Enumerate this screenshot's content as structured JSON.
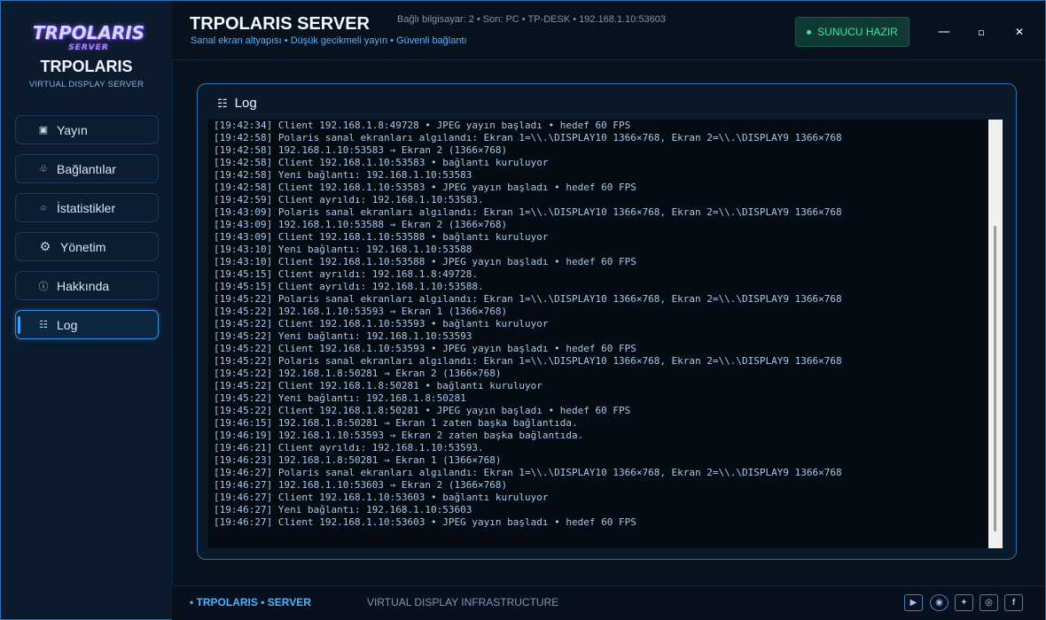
{
  "sidebar": {
    "logo_word": "TRPOLARIS",
    "logo_sub": "SERVER",
    "brand_name": "TRPOLARIS",
    "brand_sub": "VIRTUAL DISPLAY SERVER",
    "items": [
      {
        "label": "Yayın",
        "icon": "stream-icon",
        "glyph": "▣"
      },
      {
        "label": "Bağlantılar",
        "icon": "connection-icon",
        "glyph": "♧"
      },
      {
        "label": "İstatistikler",
        "icon": "stats-icon",
        "glyph": "○"
      },
      {
        "label": "Yönetim",
        "icon": "gear-icon",
        "glyph": "⚙"
      },
      {
        "label": "Hakkında",
        "icon": "info-icon",
        "glyph": "ⓘ"
      },
      {
        "label": "Log",
        "icon": "list-icon",
        "glyph": "☷",
        "active": true
      }
    ]
  },
  "header": {
    "title": "TRPOLARIS SERVER",
    "subtitle": "Sanal ekran altyapısı  •  Düşük gecikmeli yayın  •  Güvenli bağlantı",
    "connection_info": "Bağlı bilgisayar: 2  •  Son: PC • TP-DESK • 192.168.1.10:53603",
    "status": "SUNUCU HAZIR",
    "status_color": "#43e3a2",
    "controls": {
      "minimize": "—",
      "maximize": "▫",
      "close": "✕"
    }
  },
  "log": {
    "title": "Log",
    "lines": [
      "[19:42:34] Client 192.168.1.8:49728 • JPEG yayın başladı • hedef 60 FPS",
      "[19:42:58] Polaris sanal ekranları algılandı: Ekran 1=\\\\.\\DISPLAY10 1366×768, Ekran 2=\\\\.\\DISPLAY9 1366×768",
      "[19:42:58] 192.168.1.10:53583 → Ekran 2 (1366×768)",
      "[19:42:58] Client 192.168.1.10:53583 • bağlantı kuruluyor",
      "[19:42:58] Yeni bağlantı: 192.168.1.10:53583",
      "[19:42:58] Client 192.168.1.10:53583 • JPEG yayın başladı • hedef 60 FPS",
      "[19:42:59] Client ayrıldı: 192.168.1.10:53583.",
      "[19:43:09] Polaris sanal ekranları algılandı: Ekran 1=\\\\.\\DISPLAY10 1366×768, Ekran 2=\\\\.\\DISPLAY9 1366×768",
      "[19:43:09] 192.168.1.10:53588 → Ekran 2 (1366×768)",
      "[19:43:09] Client 192.168.1.10:53588 • bağlantı kuruluyor",
      "[19:43:10] Yeni bağlantı: 192.168.1.10:53588",
      "[19:43:10] Client 192.168.1.10:53588 • JPEG yayın başladı • hedef 60 FPS",
      "[19:45:15] Client ayrıldı: 192.168.1.8:49728.",
      "[19:45:15] Client ayrıldı: 192.168.1.10:53588.",
      "[19:45:22] Polaris sanal ekranları algılandı: Ekran 1=\\\\.\\DISPLAY10 1366×768, Ekran 2=\\\\.\\DISPLAY9 1366×768",
      "[19:45:22] 192.168.1.10:53593 → Ekran 1 (1366×768)",
      "[19:45:22] Client 192.168.1.10:53593 • bağlantı kuruluyor",
      "[19:45:22] Yeni bağlantı: 192.168.1.10:53593",
      "[19:45:22] Client 192.168.1.10:53593 • JPEG yayın başladı • hedef 60 FPS",
      "[19:45:22] Polaris sanal ekranları algılandı: Ekran 1=\\\\.\\DISPLAY10 1366×768, Ekran 2=\\\\.\\DISPLAY9 1366×768",
      "[19:45:22] 192.168.1.8:50281 → Ekran 2 (1366×768)",
      "[19:45:22] Client 192.168.1.8:50281 • bağlantı kuruluyor",
      "[19:45:22] Yeni bağlantı: 192.168.1.8:50281",
      "[19:45:22] Client 192.168.1.8:50281 • JPEG yayın başladı • hedef 60 FPS",
      "[19:46:15] 192.168.1.8:50281 → Ekran 1 zaten başka bağlantıda.",
      "[19:46:19] 192.168.1.10:53593 → Ekran 2 zaten başka bağlantıda.",
      "[19:46:21] Client ayrıldı: 192.168.1.10:53593.",
      "[19:46:23] 192.168.1.8:50281 → Ekran 1 (1366×768)",
      "[19:46:27] Polaris sanal ekranları algılandı: Ekran 1=\\\\.\\DISPLAY10 1366×768, Ekran 2=\\\\.\\DISPLAY9 1366×768",
      "[19:46:27] 192.168.1.10:53603 → Ekran 2 (1366×768)",
      "[19:46:27] Client 192.168.1.10:53603 • bağlantı kuruluyor",
      "[19:46:27] Yeni bağlantı: 192.168.1.10:53603",
      "[19:46:27] Client 192.168.1.10:53603 • JPEG yayın başladı • hedef 60 FPS"
    ]
  },
  "footer": {
    "brand": "•  TRPOLARIS  •  SERVER",
    "tagline": "VIRTUAL DISPLAY INFRASTRUCTURE",
    "social": [
      {
        "icon": "youtube-icon",
        "glyph": "▶"
      },
      {
        "icon": "github-icon",
        "glyph": "◉"
      },
      {
        "icon": "twitter-icon",
        "glyph": "✦"
      },
      {
        "icon": "instagram-icon",
        "glyph": "◎"
      },
      {
        "icon": "facebook-icon",
        "glyph": "f"
      }
    ]
  }
}
